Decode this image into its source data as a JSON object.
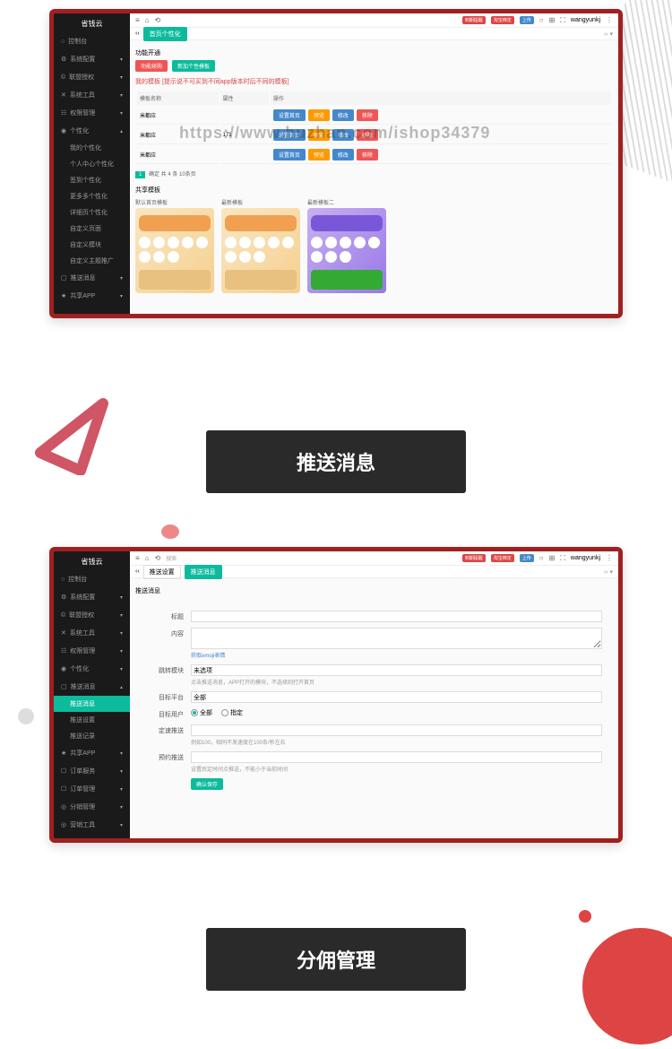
{
  "logo": "省钱云",
  "user": "wangyunkj",
  "watermark": "https://www.huzhan.com/ishop34379",
  "top_badges": [
    "到期提醒",
    "淘宝绑定",
    "上传"
  ],
  "sidebar": [
    {
      "icon": "○",
      "label": "控制台",
      "chev": ""
    },
    {
      "icon": "⚙",
      "label": "系统配置",
      "chev": "▾"
    },
    {
      "icon": "©",
      "label": "联盟授权",
      "chev": "▾"
    },
    {
      "icon": "✕",
      "label": "系统工具",
      "chev": "▾"
    },
    {
      "icon": "☷",
      "label": "权限管理",
      "chev": "▾"
    },
    {
      "icon": "◉",
      "label": "个性化",
      "chev": "▴"
    },
    {
      "icon": "▢",
      "label": "推送消息",
      "chev": "▾"
    },
    {
      "icon": "★",
      "label": "共享APP",
      "chev": "▾"
    }
  ],
  "subs1": [
    "我的个性化",
    "个人中心个性化",
    "签到个性化",
    "更多多个性化",
    "详细页个性化",
    "自定义页面",
    "自定义模块",
    "自定义主题推广"
  ],
  "tab1": "首页个性化",
  "sec1": "功能开通",
  "btns1": [
    "功能续购",
    "新加个性模板"
  ],
  "note1": "我的模板 [提示说不可买到不同app版本时后不同的模板]",
  "cols": [
    "模板名称",
    "属性",
    "操作"
  ],
  "rows": [
    {
      "name": "米都应",
      "attr": "",
      "ops": [
        "设置首页",
        "预览",
        "修改",
        "移除"
      ]
    },
    {
      "name": "米都应",
      "attr": "171",
      "ops": [
        "设置首页",
        "预览",
        "修改",
        "移除"
      ]
    },
    {
      "name": "米都应",
      "attr": "",
      "ops": [
        "设置首页",
        "预览",
        "修改",
        "移除"
      ]
    }
  ],
  "pager": {
    "page": "1",
    "info": "确定 共 4 条 10条页"
  },
  "sec2": "共享模板",
  "cards": [
    "默认首页模板",
    "最新模板",
    "最新模板二"
  ],
  "title1": "推送消息",
  "sidebar2": [
    {
      "icon": "○",
      "label": "控制台",
      "chev": ""
    },
    {
      "icon": "⚙",
      "label": "系统配置",
      "chev": "▾"
    },
    {
      "icon": "©",
      "label": "联盟授权",
      "chev": "▾"
    },
    {
      "icon": "✕",
      "label": "系统工具",
      "chev": "▾"
    },
    {
      "icon": "☷",
      "label": "权限管理",
      "chev": "▾"
    },
    {
      "icon": "◉",
      "label": "个性化",
      "chev": "▾"
    },
    {
      "icon": "▢",
      "label": "推送消息",
      "chev": "▴"
    },
    {
      "icon": "★",
      "label": "共享APP",
      "chev": "▾"
    },
    {
      "icon": "☐",
      "label": "订单服务",
      "chev": "▾"
    },
    {
      "icon": "☐",
      "label": "订单管理",
      "chev": "▾"
    },
    {
      "icon": "◎",
      "label": "分销管理",
      "chev": "▾"
    },
    {
      "icon": "◎",
      "label": "营销工具",
      "chev": "▾"
    }
  ],
  "subs2": [
    "推送消息",
    "推送设置",
    "推送记录"
  ],
  "breadcrumb": [
    "推送设置",
    "推送消息"
  ],
  "form_title": "推送消息",
  "fields": {
    "f1": "标题",
    "f2": "内容",
    "emoji": "获取emoji表情",
    "f3": "跳转模块",
    "f3v": "未选项",
    "f3h": "点击推送消息，APP打开的模块，不选择则打开首页",
    "f4": "目标平台",
    "f4v": "全部",
    "f5": "目标用户",
    "r1": "全部",
    "r2": "指定",
    "f6": "定速推送",
    "f6h": "例如100，相同不发速度在100条/秒左右",
    "f7": "预约推送",
    "f7h": "设置后定时间点推送，不能小于当前时间",
    "submit": "确认保存"
  },
  "title2": "分佣管理"
}
